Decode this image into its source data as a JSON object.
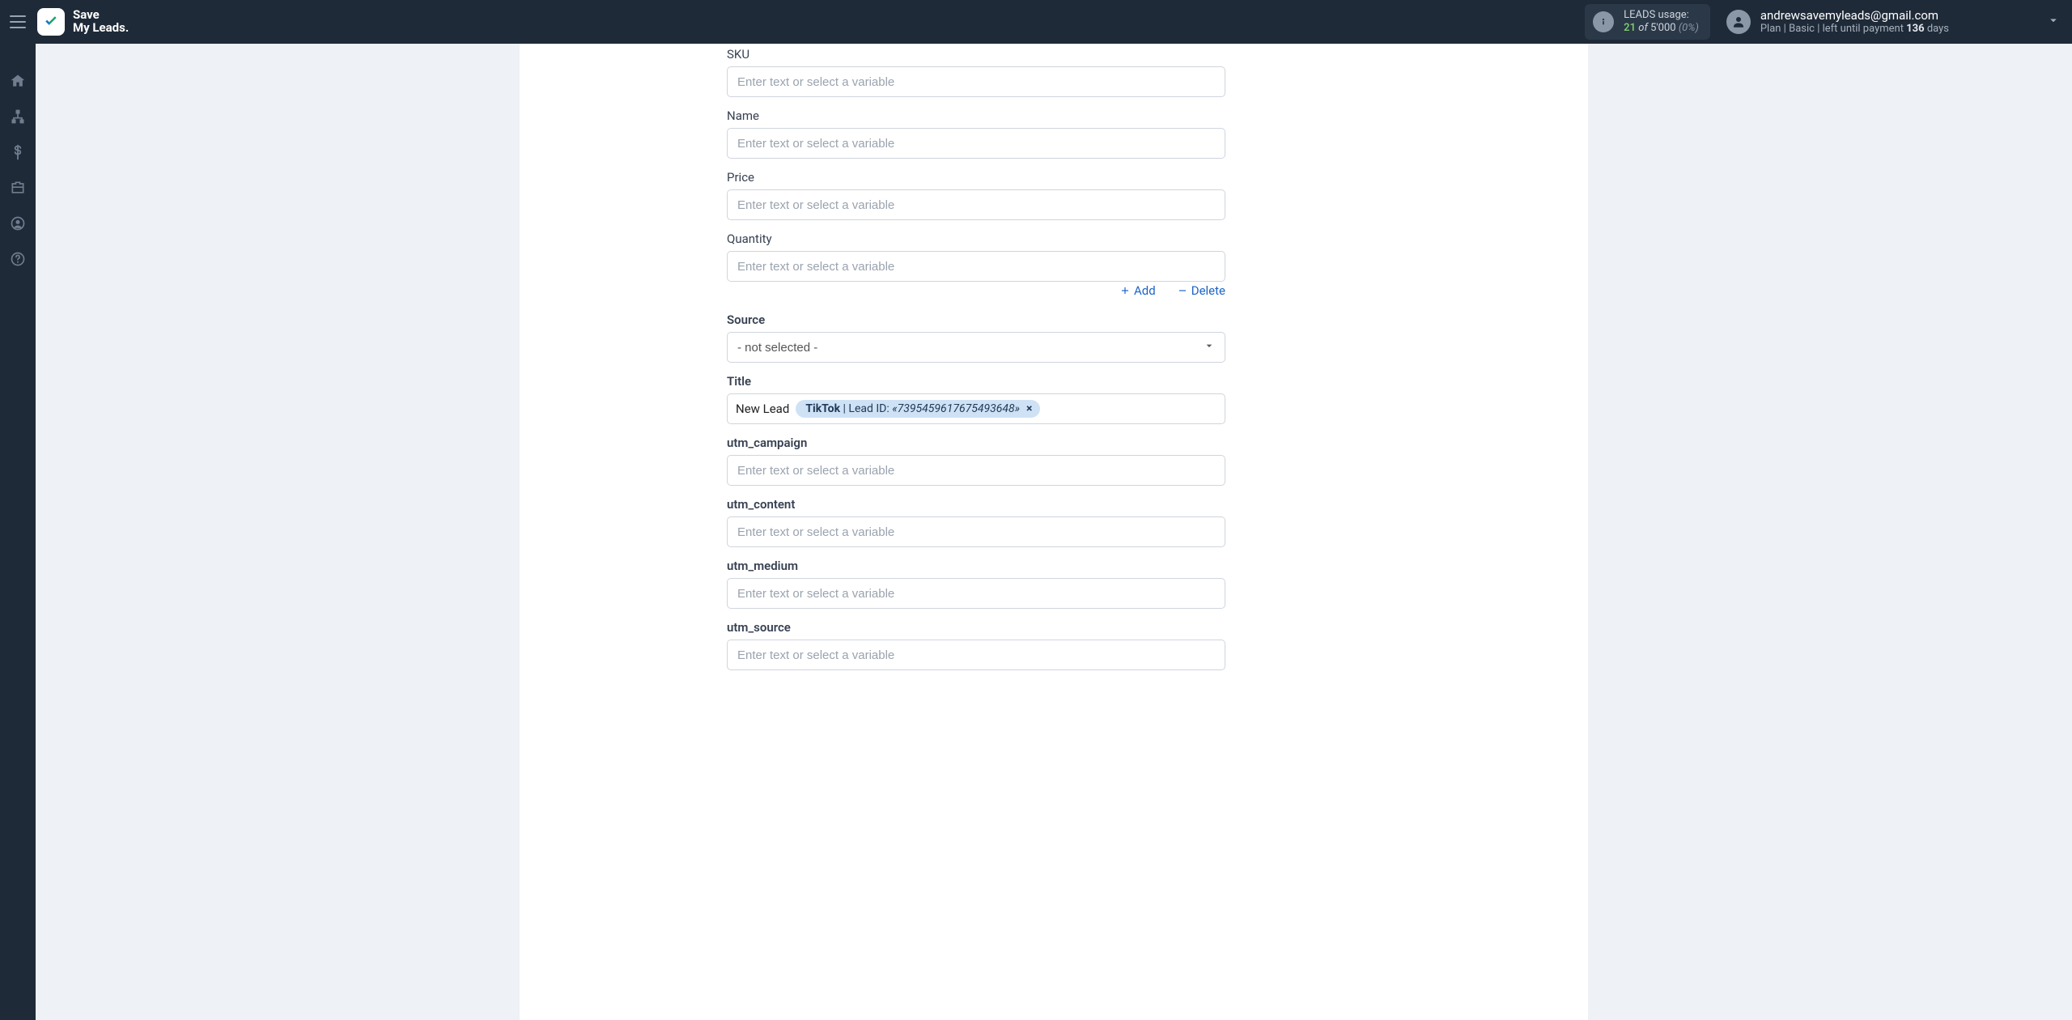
{
  "header": {
    "brand_line1": "Save",
    "brand_line2": "My Leads",
    "brand_dot": ".",
    "usage": {
      "label": "LEADS usage:",
      "current": "21",
      "of": "of",
      "max": "5'000",
      "pct": "(0%)"
    },
    "user": {
      "email": "andrewsavemyleads@gmail.com",
      "plan_prefix": "Plan |",
      "plan_name": "Basic",
      "plan_sep": "|",
      "left_text": "left until payment",
      "days_num": "136",
      "days_word": "days"
    }
  },
  "form": {
    "placeholder": "Enter text or select a variable",
    "fields": {
      "sku": {
        "label": "SKU"
      },
      "name": {
        "label": "Name"
      },
      "price": {
        "label": "Price"
      },
      "quantity": {
        "label": "Quantity"
      },
      "source": {
        "label": "Source",
        "selected": "- not selected -"
      },
      "title": {
        "label": "Title",
        "pretext": "New Lead",
        "chip_source": "TikTok",
        "chip_lead_label": " | Lead ID: ",
        "chip_lead_id": "«7395459617675493648»"
      },
      "utm_campaign": {
        "label": "utm_campaign"
      },
      "utm_content": {
        "label": "utm_content"
      },
      "utm_medium": {
        "label": "utm_medium"
      },
      "utm_source": {
        "label": "utm_source"
      }
    },
    "actions": {
      "add": "Add",
      "delete": "Delete"
    }
  }
}
